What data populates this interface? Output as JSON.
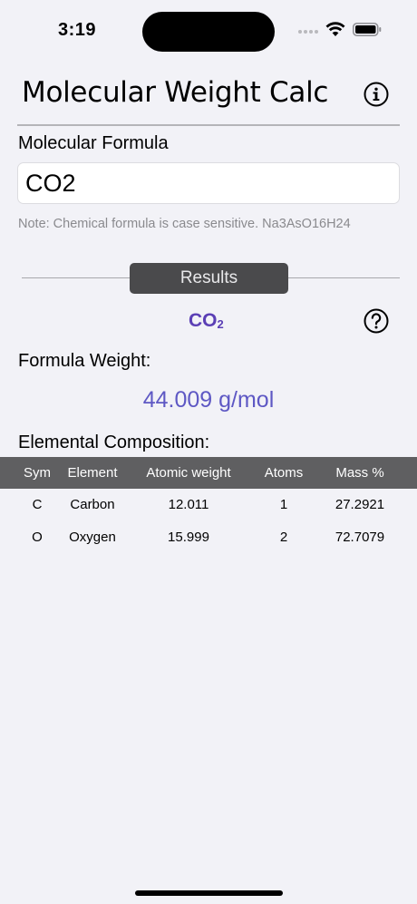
{
  "status": {
    "time": "3:19"
  },
  "header": {
    "title": "Molecular Weight Calc"
  },
  "input": {
    "label": "Molecular Formula",
    "value": "CO2",
    "note": "Note: Chemical formula is case sensitive. Na3AsO16H24"
  },
  "results": {
    "label": "Results",
    "formula_base": "CO",
    "formula_sub": "2",
    "weight_label": "Formula Weight:",
    "weight_value": "44.009 g/mol",
    "composition_label": "Elemental Composition:"
  },
  "table": {
    "headers": [
      "Sym",
      "Element",
      "Atomic weight",
      "Atoms",
      "Mass %"
    ],
    "rows": [
      [
        "C",
        "Carbon",
        "12.011",
        "1",
        "27.2921"
      ],
      [
        "O",
        "Oxygen",
        "15.999",
        "2",
        "72.7079"
      ]
    ]
  },
  "colors": {
    "accent": "#5e58c4",
    "formula": "#5b3fb5",
    "table_header": "#5f5f61",
    "background": "#f2f2f7"
  },
  "icons": {
    "info": "info-circle-icon",
    "help": "question-circle-icon",
    "wifi": "wifi-icon",
    "battery": "battery-icon"
  }
}
